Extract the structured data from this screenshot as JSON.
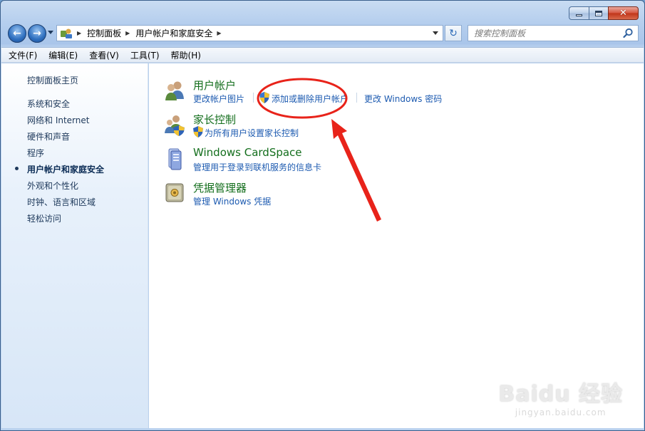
{
  "window": {
    "caption": {
      "minimize": "_",
      "maximize": "□",
      "close": "✕"
    }
  },
  "nav": {
    "back_label": "←",
    "forward_label": "→",
    "breadcrumbs": [
      "控制面板",
      "用户帐户和家庭安全"
    ],
    "refresh_label": "↻"
  },
  "search": {
    "placeholder": "搜索控制面板"
  },
  "menubar": {
    "items": [
      "文件(F)",
      "编辑(E)",
      "查看(V)",
      "工具(T)",
      "帮助(H)"
    ]
  },
  "sidebar": {
    "items": [
      {
        "label": "控制面板主页"
      },
      {
        "label": "系统和安全"
      },
      {
        "label": "网络和 Internet"
      },
      {
        "label": "硬件和声音"
      },
      {
        "label": "程序"
      },
      {
        "label": "用户帐户和家庭安全",
        "current": true
      },
      {
        "label": "外观和个性化"
      },
      {
        "label": "时钟、语言和区域"
      },
      {
        "label": "轻松访问"
      }
    ]
  },
  "categories": [
    {
      "title": "用户帐户",
      "icon": "users-icon",
      "links": [
        "更改帐户图片",
        "添加或删除用户帐户",
        "更改 Windows 密码"
      ]
    },
    {
      "title": "家长控制",
      "icon": "parental-controls-icon",
      "links": [
        "为所有用户设置家长控制"
      ]
    },
    {
      "title": "Windows CardSpace",
      "icon": "cardspace-icon",
      "links": [
        "管理用于登录到联机服务的信息卡"
      ]
    },
    {
      "title": "凭据管理器",
      "icon": "credential-manager-icon",
      "links": [
        "管理 Windows 凭据"
      ]
    }
  ],
  "colors": {
    "link": "#1c5ab0",
    "category_title": "#136e1c",
    "annotation": "#e8231a"
  },
  "watermark": {
    "logo": "Baidu 经验",
    "url": "jingyan.baidu.com"
  }
}
